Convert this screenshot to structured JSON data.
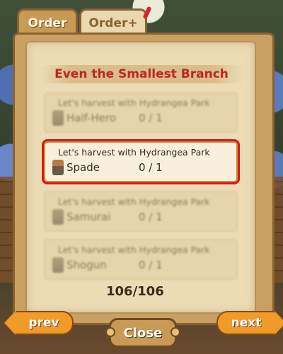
{
  "tabs": [
    {
      "label": "Order"
    },
    {
      "label": "Order+"
    }
  ],
  "panel": {
    "title": "Even the Smallest Branch"
  },
  "orders": [
    {
      "quest": "Let's harvest with Hydrangea Park",
      "name": "Half-Hero",
      "count": "0 / 1"
    },
    {
      "quest": "Let's harvest with Hydrangea Park",
      "name": "Spade",
      "count": "0 / 1"
    },
    {
      "quest": "Let's harvest with Hydrangea Park",
      "name": "Samurai",
      "count": "0 / 1"
    },
    {
      "quest": "Let's harvest with Hydrangea Park",
      "name": "Shogun",
      "count": "0 / 1"
    }
  ],
  "pagination": {
    "current": "106",
    "separator": "/",
    "total": "106"
  },
  "buttons": {
    "prev": "prev",
    "close": "Close",
    "next": "next"
  }
}
